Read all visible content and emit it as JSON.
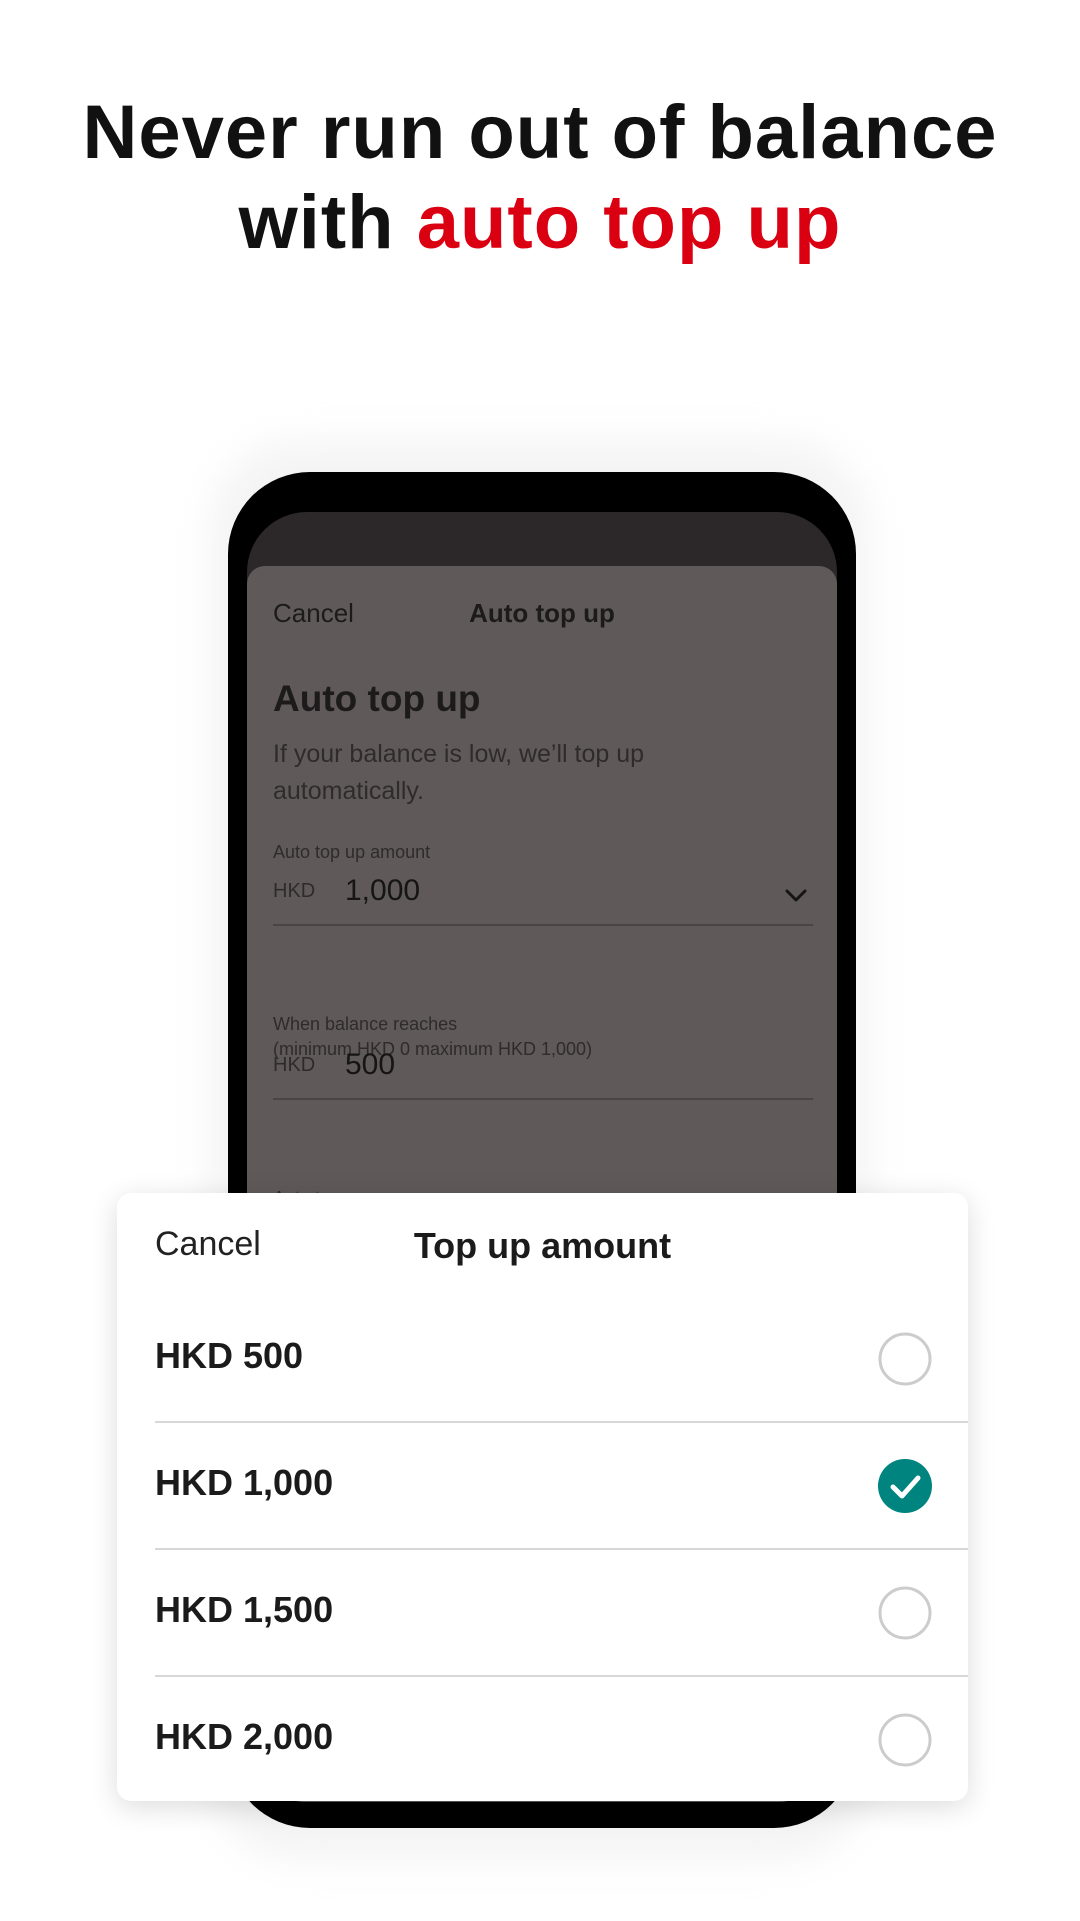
{
  "headline": {
    "line1": "Never run out of balance",
    "line2_prefix": "with ",
    "line2_accent": "auto top up"
  },
  "colors": {
    "accent": "#db0011",
    "check": "#00847f",
    "radio_border": "#cccccc"
  },
  "background_screen": {
    "cancel": "Cancel",
    "title": "Auto top up",
    "heading": "Auto top up",
    "description": "If your balance is low, we’ll top up automatically.",
    "amount_label": "Auto top up amount",
    "amount_currency": "HKD",
    "amount_value": "1,000",
    "threshold_label_1": "When balance reaches",
    "threshold_label_2": "(minimum HKD 0 maximum HKD 1,000)",
    "threshold_currency": "HKD",
    "threshold_value": "500",
    "source_label": "Auto top up source"
  },
  "picker": {
    "cancel": "Cancel",
    "title": "Top up amount",
    "options": [
      {
        "label": "HKD 500",
        "selected": false
      },
      {
        "label": "HKD 1,000",
        "selected": true
      },
      {
        "label": "HKD 1,500",
        "selected": false
      },
      {
        "label": "HKD 2,000",
        "selected": false
      }
    ]
  }
}
